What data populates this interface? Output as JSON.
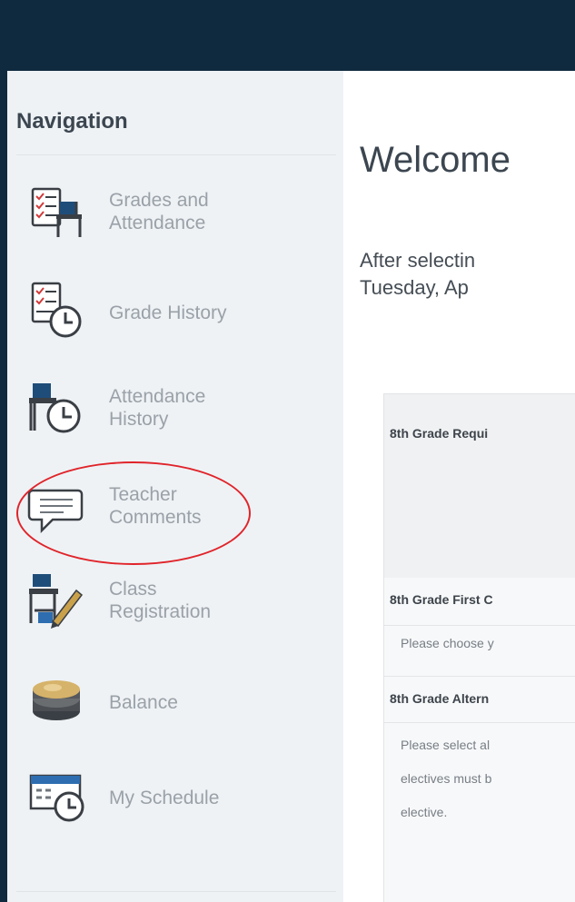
{
  "colors": {
    "header_bg": "#0f2a3e",
    "sidebar_bg": "#eef2f5",
    "nav_label": "#9aa1a8",
    "highlight": "#e0242a",
    "icon_navy": "#1f4d7a",
    "icon_blue": "#2d6db0"
  },
  "sidebar": {
    "title": "Navigation",
    "items": [
      {
        "label": "Grades and\nAttendance",
        "icon": "grades-attendance-icon"
      },
      {
        "label": "Grade History",
        "icon": "grade-history-icon"
      },
      {
        "label": "Attendance\nHistory",
        "icon": "attendance-history-icon"
      },
      {
        "label": "Teacher\nComments",
        "icon": "teacher-comments-icon"
      },
      {
        "label": "Class\nRegistration",
        "icon": "class-registration-icon",
        "highlighted": true
      },
      {
        "label": "Balance",
        "icon": "balance-icon"
      },
      {
        "label": "My Schedule",
        "icon": "my-schedule-icon"
      }
    ]
  },
  "main": {
    "heading": "Welcome",
    "intro": "After selectin\nTuesday, Ap",
    "sections": [
      {
        "title": "8th Grade Requi",
        "text": ""
      },
      {
        "title": "8th Grade First C",
        "text": "Please choose y"
      },
      {
        "title": "8th Grade Altern",
        "text": "Please select al\nelectives must b\nelective."
      }
    ]
  }
}
